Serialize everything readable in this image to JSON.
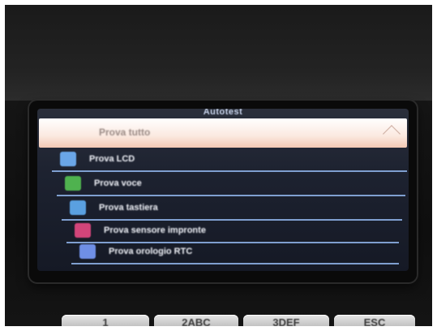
{
  "screen": {
    "title": "Autotest",
    "selected_item": {
      "label": "Prova tutto"
    },
    "items": [
      {
        "label": "Prova LCD",
        "icon": "lcd-icon",
        "icon_color": "#6aa6e8"
      },
      {
        "label": "Prova voce",
        "icon": "speaker-icon",
        "icon_color": "#4fb24f"
      },
      {
        "label": "Prova tastiera",
        "icon": "keyboard-icon",
        "icon_color": "#5aa0e0"
      },
      {
        "label": "Prova sensore impronte",
        "icon": "fingerprint-icon",
        "icon_color": "#d2457a"
      },
      {
        "label": "Prova orologio RTC",
        "icon": "clock-icon",
        "icon_color": "#6f8fe6"
      }
    ]
  },
  "keypad": {
    "keys": [
      {
        "label": "1"
      },
      {
        "label": "2ABC"
      },
      {
        "label": "3DEF"
      },
      {
        "label": "ESC"
      }
    ]
  }
}
